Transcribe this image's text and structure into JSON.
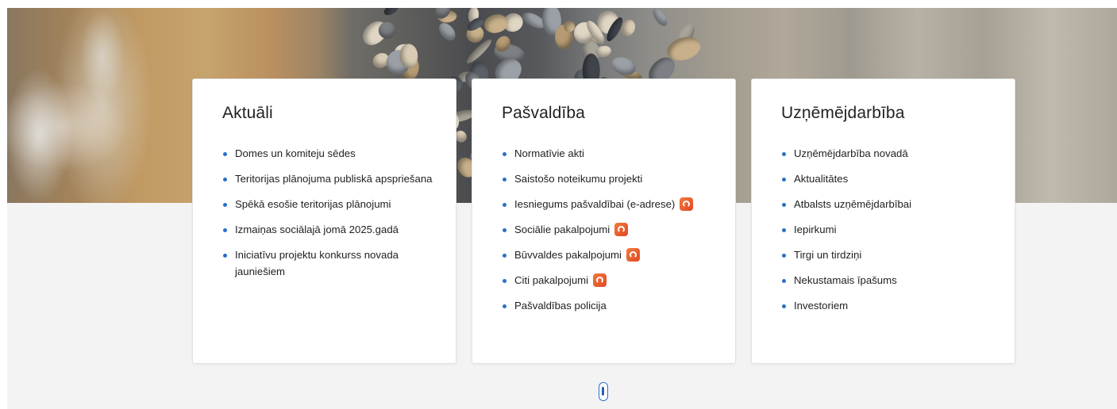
{
  "cards": [
    {
      "title": "Aktuāli",
      "items": [
        {
          "label": "Domes un komiteju sēdes"
        },
        {
          "label": "Teritorijas plānojuma publiskā apspriešana"
        },
        {
          "label": "Spēkā esošie teritorijas plānojumi"
        },
        {
          "label": "Izmaiņas sociālajā jomā 2025.gadā"
        },
        {
          "label": "Iniciatīvu projektu konkurss novada jauniešiem"
        }
      ]
    },
    {
      "title": "Pašvaldība",
      "items": [
        {
          "label": "Normatīvie akti"
        },
        {
          "label": "Saistošo noteikumu projekti"
        },
        {
          "label": "Iesniegums pašvaldībai (e-adrese)",
          "icon": "e-services-icon"
        },
        {
          "label": "Sociālie pakalpojumi",
          "icon": "e-services-icon"
        },
        {
          "label": "Būvvaldes pakalpojumi",
          "icon": "e-services-icon"
        },
        {
          "label": "Citi pakalpojumi",
          "icon": "e-services-icon"
        },
        {
          "label": "Pašvaldības policija"
        }
      ]
    },
    {
      "title": "Uzņēmējdarbība",
      "items": [
        {
          "label": "Uzņēmējdarbība novadā"
        },
        {
          "label": "Aktualitātes"
        },
        {
          "label": "Atbalsts uzņēmējdarbībai"
        },
        {
          "label": "Iepirkumi"
        },
        {
          "label": "Tirgi un tirdziņi"
        },
        {
          "label": "Nekustamais īpašums"
        },
        {
          "label": "Investoriem"
        }
      ]
    }
  ],
  "colors": {
    "accent": "#2a6fc9",
    "badge": "#e8572c",
    "page_background": "#f3f3f4"
  },
  "hero": {
    "image": "beach-stones-photo"
  }
}
